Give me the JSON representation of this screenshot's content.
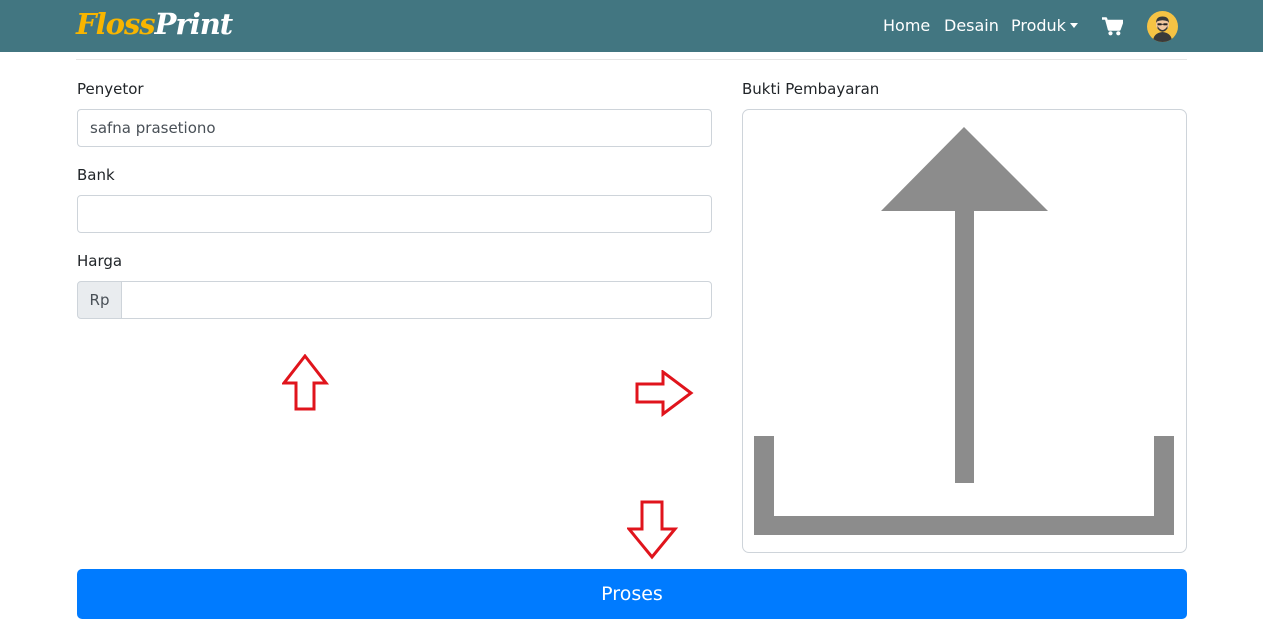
{
  "app": {
    "brand_part1": "Floss",
    "brand_part2": "Print",
    "brand_color_1": "#f8b500",
    "navbar_color": "#427681"
  },
  "nav": {
    "home": "Home",
    "desain": "Desain",
    "produk": "Produk",
    "cart_icon": "shopping-cart-icon",
    "avatar_icon": "user-avatar-icon"
  },
  "form": {
    "penyetor_label": "Penyetor",
    "penyetor_value": "safna prasetiono",
    "bank_label": "Bank",
    "bank_value": "",
    "harga_label": "Harga",
    "harga_prefix": "Rp",
    "harga_value": ""
  },
  "upload": {
    "label": "Bukti Pembayaran",
    "icon": "upload-icon"
  },
  "actions": {
    "proses_label": "Proses",
    "button_color": "#007bff"
  },
  "annotations": {
    "color": "#e0141c",
    "marks": [
      "arrow-up",
      "arrow-right",
      "arrow-down"
    ]
  }
}
